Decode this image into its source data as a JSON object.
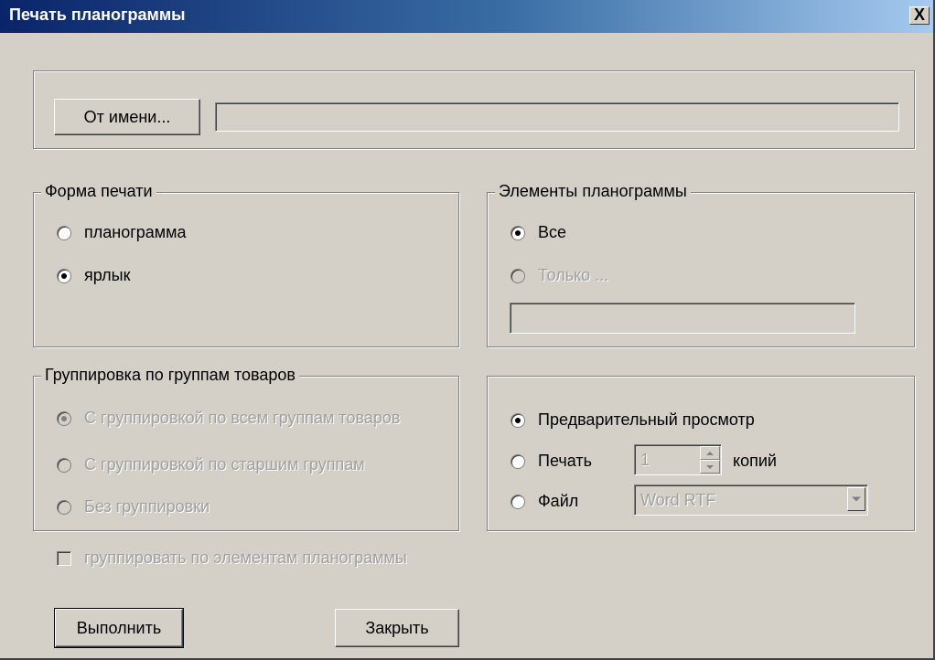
{
  "window": {
    "title": "Печать планограммы",
    "close_glyph": "X"
  },
  "from_name": {
    "button_label": "От имени...",
    "field_value": ""
  },
  "print_form": {
    "legend": "Форма печати",
    "options": [
      {
        "label": "планограмма",
        "checked": false
      },
      {
        "label": "ярлык",
        "checked": true
      }
    ]
  },
  "elements": {
    "legend": "Элементы планограммы",
    "options": [
      {
        "label": "Все",
        "checked": true,
        "enabled": true
      },
      {
        "label": "Только ...",
        "checked": false,
        "enabled": false
      }
    ],
    "only_field_value": ""
  },
  "grouping": {
    "legend": "Группировка по группам товаров",
    "options": [
      {
        "label": "С группировкой по всем группам товаров",
        "checked": true,
        "enabled": false
      },
      {
        "label": "С группировкой по старшим группам",
        "checked": false,
        "enabled": false
      },
      {
        "label": "Без группировки",
        "checked": false,
        "enabled": false
      }
    ]
  },
  "output": {
    "preview_label": "Предварительный просмотр",
    "print_label": "Печать",
    "copies_value": "1",
    "copies_label": "копий",
    "file_label": "Файл",
    "file_format": "Word RTF",
    "selected": "preview"
  },
  "group_by_elements": {
    "label": "группировать по элементам планограммы",
    "checked": false,
    "enabled": false
  },
  "buttons": {
    "execute": "Выполнить",
    "close": "Закрыть"
  }
}
